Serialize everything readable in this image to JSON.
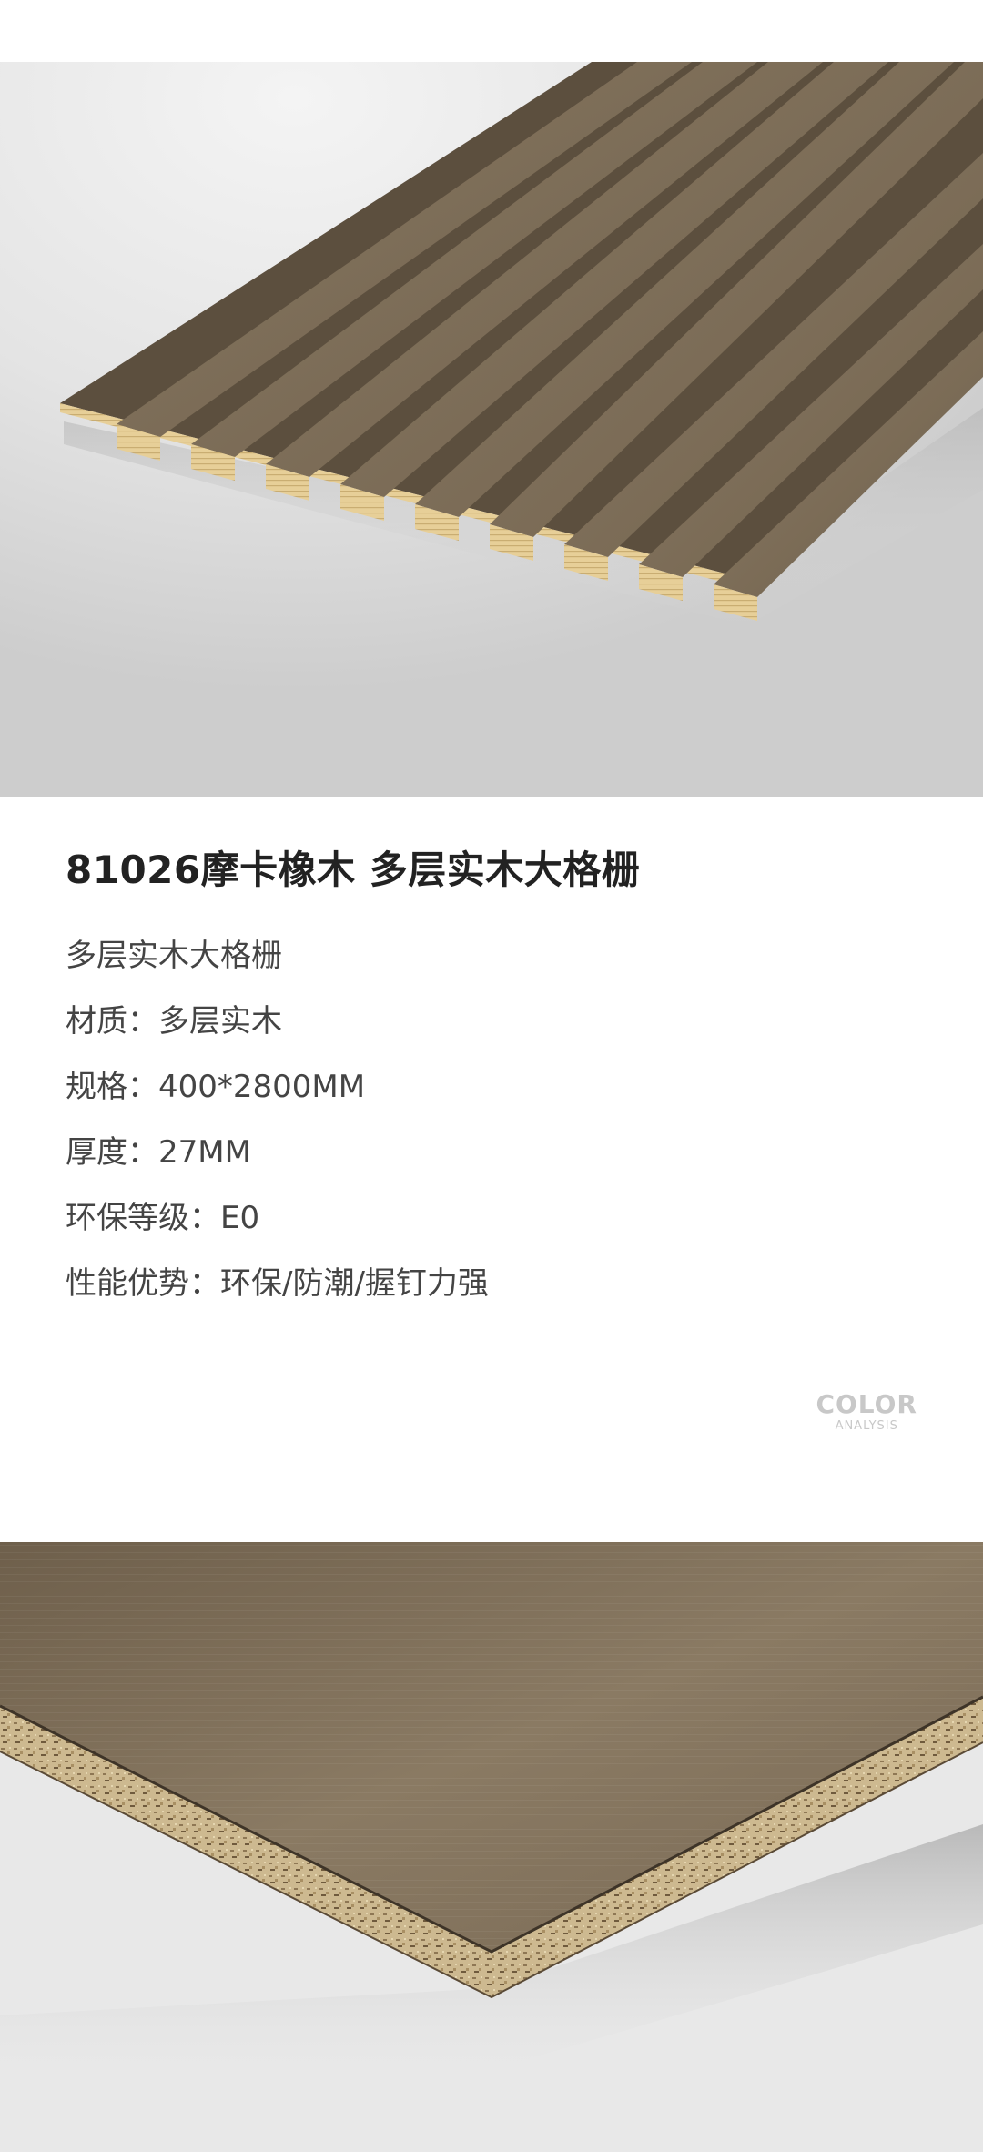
{
  "product": {
    "title": "81026摩卡橡木  多层实木大格栅",
    "subtitle": "多层实木大格栅",
    "specs": [
      {
        "label": "材质：",
        "value": "多层实木"
      },
      {
        "label": "规格：",
        "value": "400*2800MM"
      },
      {
        "label": "厚度：",
        "value": "27MM"
      },
      {
        "label": "环保等级：",
        "value": "E0"
      },
      {
        "label": "性能优势：",
        "value": "环保/防潮/握钉力强"
      }
    ]
  },
  "badge": {
    "main": "COLOR",
    "sub": "ANALYSIS"
  },
  "colors": {
    "wood": "#7a6a55",
    "wood_dark": "#5e4f3e",
    "core_edge": "#e2c98f",
    "particle": "#c8b48c",
    "text_title": "#222222",
    "text_spec": "#444444"
  },
  "images": {
    "top": "wooden-slat-panel-image",
    "bottom": "board-cross-section-image"
  }
}
